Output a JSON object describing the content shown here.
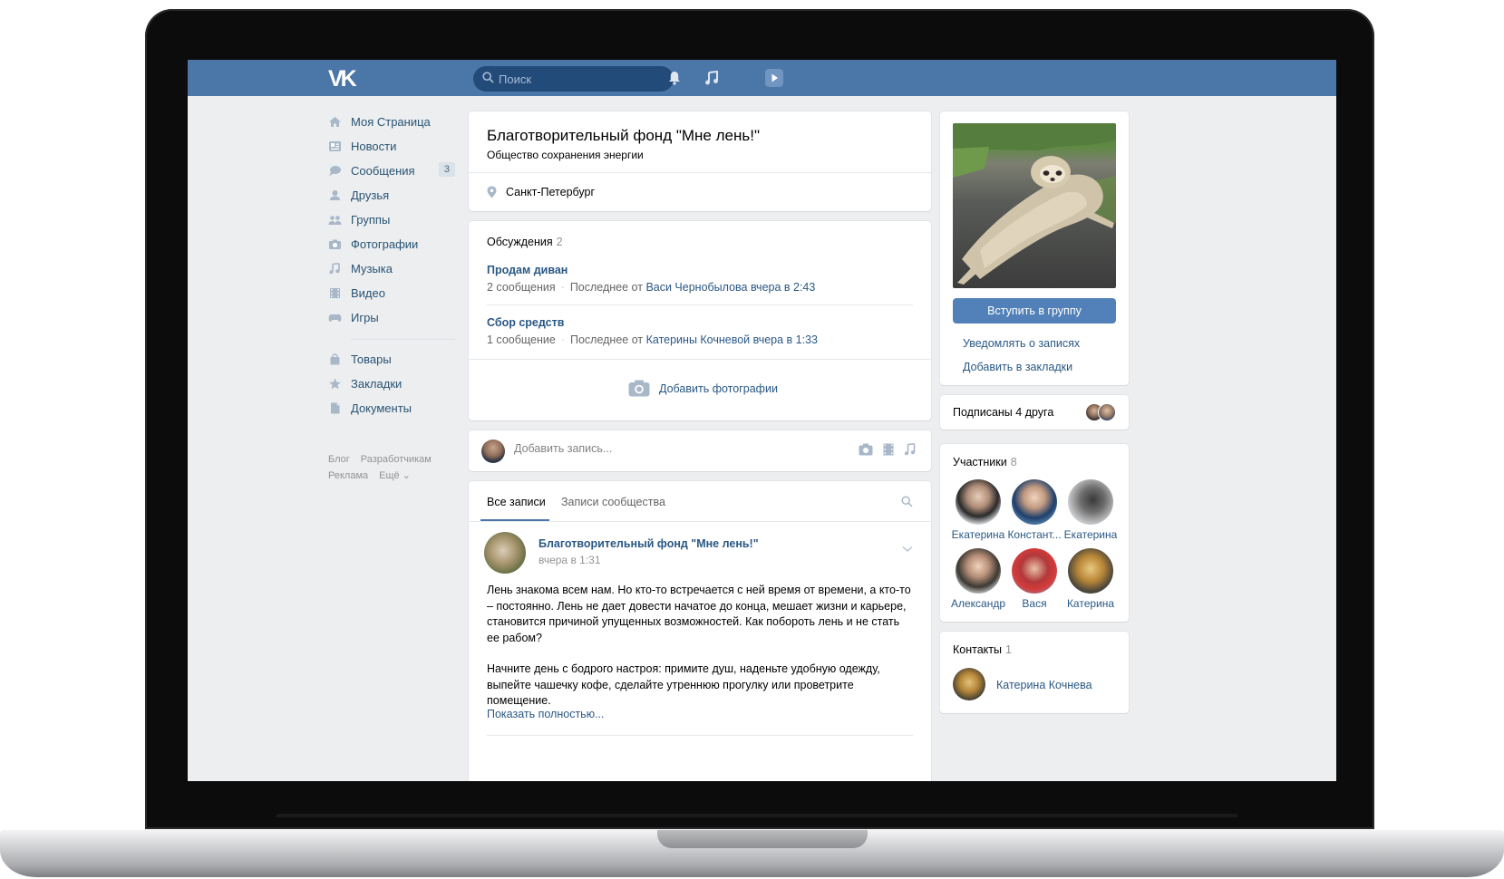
{
  "topbar": {
    "logo": "VK",
    "search_placeholder": "Поиск"
  },
  "sidebar": {
    "items": [
      {
        "label": "Моя Страница",
        "icon": "home-icon"
      },
      {
        "label": "Новости",
        "icon": "news-icon"
      },
      {
        "label": "Сообщения",
        "icon": "messages-icon",
        "badge": "3"
      },
      {
        "label": "Друзья",
        "icon": "friends-icon"
      },
      {
        "label": "Группы",
        "icon": "groups-icon"
      },
      {
        "label": "Фотографии",
        "icon": "photos-icon"
      },
      {
        "label": "Музыка",
        "icon": "music-icon"
      },
      {
        "label": "Видео",
        "icon": "video-icon"
      },
      {
        "label": "Игры",
        "icon": "games-icon"
      },
      {
        "label": "Товары",
        "icon": "market-icon"
      },
      {
        "label": "Закладки",
        "icon": "bookmarks-icon"
      },
      {
        "label": "Документы",
        "icon": "documents-icon"
      }
    ],
    "footer": [
      "Блог",
      "Разработчикам",
      "Реклама",
      "Ещё ⌄"
    ]
  },
  "group": {
    "title": "Благотворительный фонд \"Мне лень!\"",
    "status": "Общество сохранения энергии",
    "city": "Санкт-Петербург"
  },
  "discussions": {
    "heading": "Обсуждения",
    "count": "2",
    "topics": [
      {
        "title": "Продам диван",
        "messages": "2 сообщения",
        "last_prefix": "Последнее от",
        "last_link": "Васи Чернобылова вчера в 2:43"
      },
      {
        "title": "Сбор средств",
        "messages": "1 сообщение",
        "last_prefix": "Последнее от",
        "last_link": "Катерины Кочневой вчера в 1:33"
      }
    ],
    "add_photos": "Добавить фотографии"
  },
  "post_add": {
    "placeholder": "Добавить запись..."
  },
  "wall": {
    "tabs": [
      "Все записи",
      "Записи сообщества"
    ],
    "post": {
      "author": "Благотворительный фонд \"Мне лень!\"",
      "date": "вчера в 1:31",
      "paragraph1": "Лень знакома всем нам. Но кто-то встречается с ней время от времени, а кто-то – постоянно. Лень не дает довести начатое до конца, мешает жизни и карьере, становится причиной упущенных возможностей. Как побороть лень и не стать ее рабом?",
      "paragraph2": "Начните день с бодрого настроя: примите душ, наденьте удобную одежду, выпейте чашечку кофе, сделайте утреннюю прогулку или проветрите помещение.",
      "show_more": "Показать полностью..."
    }
  },
  "sidebar_right": {
    "join_button": "Вступить в группу",
    "notify_link": "Уведомлять о записях",
    "bookmark_link": "Добавить в закладки",
    "friends_subscribed": "Подписаны 4 друга",
    "members_heading": "Участники",
    "members_count": "8",
    "members": [
      "Екатерина",
      "Констант...",
      "Екатерина",
      "Александр",
      "Вася",
      "Катерина"
    ],
    "contacts_heading": "Контакты",
    "contacts_count": "1",
    "contact_name": "Катерина Кочнева"
  },
  "colors": {
    "header_blue": "#4a76a8",
    "link": "#2a5885",
    "button": "#5181b8",
    "page_bg": "#edeef0"
  }
}
